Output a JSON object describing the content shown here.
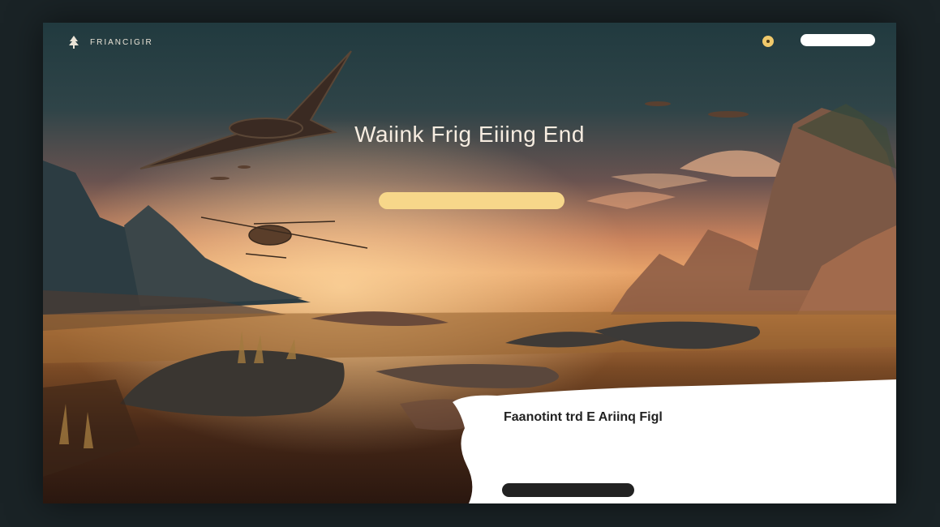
{
  "nav": {
    "brand": "FRIANCIGIR",
    "links": [
      "",
      "",
      "",
      "",
      "",
      ""
    ],
    "cta_label": ""
  },
  "hero": {
    "eyebrow": "",
    "title": "Waiink Frig Eiiing End",
    "body": "",
    "cta_label": ""
  },
  "card": {
    "title": "Faanotint trd E Ariinq Figl",
    "body": "",
    "button_label": ""
  },
  "colors": {
    "accent": "#f7d78a",
    "dark": "#213a3f",
    "card": "#ffffff"
  }
}
